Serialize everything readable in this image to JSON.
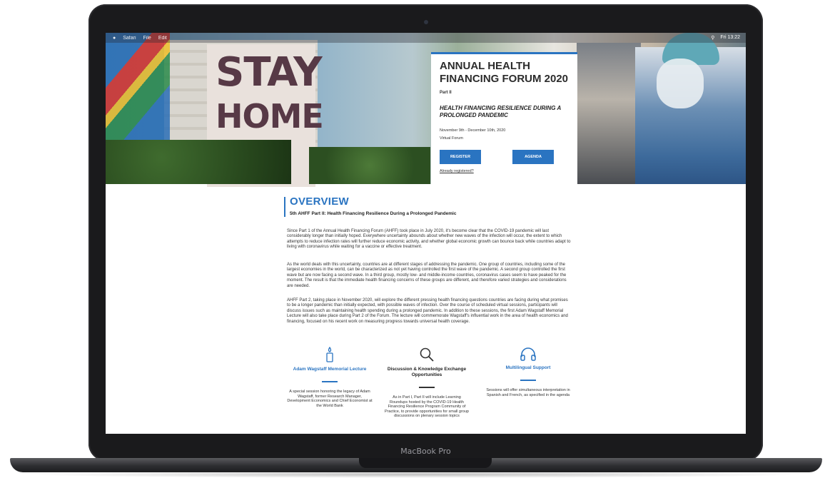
{
  "device": {
    "brand_label": "MacBook Pro"
  },
  "menubar": {
    "apple": "",
    "items": [
      "Safari",
      "File",
      "Edit"
    ],
    "clock": "Fri 13:22"
  },
  "hero": {
    "poster_line1": "STAY",
    "poster_line2": "HOME"
  },
  "card": {
    "title": "ANNUAL HEALTH FINANCING FORUM 2020",
    "part": "Part II",
    "subtitle": "HEALTH FINANCING RESILIENCE DURING A PROLONGED PANDEMIC",
    "dates": "November 9th - December 10th, 2020",
    "venue": "Virtual Forum",
    "register_label": "REGISTER",
    "agenda_label": "AGENDA",
    "already_registered": "Already registered?"
  },
  "overview": {
    "heading": "OVERVIEW",
    "subheading": "5th AHFF Part II: Health Financing Resilience During a Prolonged Pandemic",
    "paragraphs": [
      "Since Part 1 of the Annual Health Financing Forum (AHFF) took place in July 2020, it's become clear that the COVID-19 pandemic will last considerably longer than initially hoped. Everywhere uncertainty abounds about whether new waves of the infection will occur, the extent to which attempts to reduce infection rates will further reduce economic activity, and whether global economic growth can bounce back while countries adapt to living with coronavirus while waiting for a vaccine or effective treatment.",
      "As the world deals with this uncertainty, countries are at different stages of addressing the pandemic. One group of countries, including some of the largest economies in the world, can be characterized as not yet having controlled the first wave of the pandemic. A second group controlled the first wave but are now facing a second wave. In a third group, mostly low- and middle-income countries, coronavirus cases seem to have peaked for the moment. The result is that the immediate health financing concerns of these groups are different, and therefore varied strategies and considerations are needed.",
      "AHFF Part 2, taking place in November 2020, will explore the different pressing health financing questions countries are facing during what promises to be a longer pandemic than initially expected, with possible waves of infection. Over the course of scheduled virtual sessions, participants will discuss issues such as maintaining health spending during a prolonged pandemic. In addition to these sessions, the first Adam Wagstaff Memorial Lecture will also take place during Part 2 of the Forum. The lecture will commemorate Wagstaff's influential work in the area of health economics and financing, focused on his recent work on measuring progress towards universal health coverage."
    ]
  },
  "features": [
    {
      "icon": "candle-icon",
      "title": "Adam Wagstaff Memorial Lecture",
      "desc": "A special session honoring the legacy of Adam Wagstaff, former Research Manager, Development Economics and Chief Economist at the World Bank"
    },
    {
      "icon": "search-icon",
      "title": "Discussion & Knowledge Exchange Opportunities",
      "desc": "As in Part I, Part II will include Learning Roundups hosted by the COVID-19 Health Financing Resilience Program Community of Practice, to provide opportunities for small group discussions on plenary session topics"
    },
    {
      "icon": "headphones-icon",
      "title": "Multilingual Support",
      "desc": "Sessions will offer simultaneous interpretation in Spanish and French, as specified in the agenda"
    }
  ],
  "colors": {
    "accent": "#2a74c1",
    "text": "#333333"
  }
}
